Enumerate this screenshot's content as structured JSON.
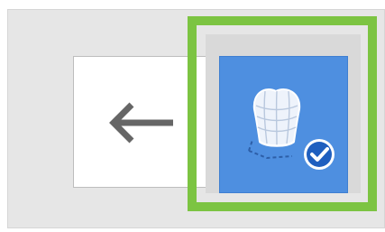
{
  "toolbar": {
    "back_button": {
      "icon": "arrow-left-icon",
      "color": "#666666"
    },
    "selected_tool": {
      "icon": "dental-crown-icon",
      "badge_icon": "check-circle-icon",
      "tile_color": "#4e8fe0",
      "badge_color": "#1f5fbf",
      "state": "selected"
    },
    "highlight_color": "#7cc442"
  }
}
